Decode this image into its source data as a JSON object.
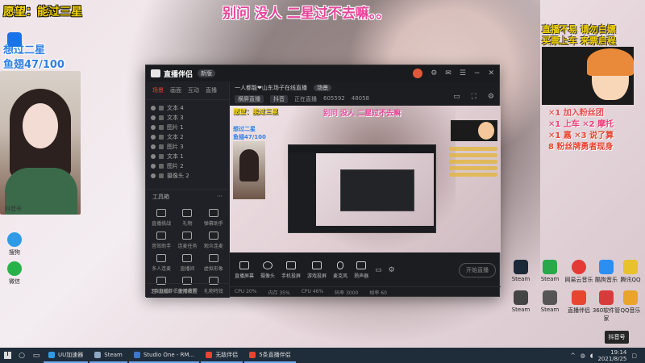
{
  "overlay": {
    "top_left": "愿望：能过三星",
    "top_center": "别问 没人 二星过不去嘛。。",
    "left_line1": "想过二星",
    "left_line2": "鱼翅47/100",
    "cam_label": "抖音号"
  },
  "desktop_left": [
    {
      "label": "抖音号",
      "color": "#1a73e8"
    },
    {
      "label": "搜狗",
      "color": "#2f9be6"
    },
    {
      "label": "微信",
      "color": "#27b34a"
    }
  ],
  "right_panel": {
    "title_line1": "直播不易 请勿白嫖",
    "title_line2": "买票上车 来票启程",
    "lines": [
      {
        "text": "✕1 加入粉丝团",
        "color": "#e84a4a"
      },
      {
        "text": "✕1 上车  ✕2 摩托",
        "color": "#ef3f7a"
      },
      {
        "text": "✕1 嘉  ✕3 说了算",
        "color": "#e8452f"
      },
      {
        "text": "8 粉丝牌勇者现身",
        "color": "#e8452f"
      }
    ]
  },
  "app": {
    "name": "直播伴侣",
    "badge": "新版",
    "tabs": [
      "场景",
      "画面",
      "互动",
      "直播"
    ],
    "active_tab": "场景",
    "layers": [
      "文本 4",
      "文本 3",
      "图片 1",
      "文本 2",
      "图片 3",
      "文本 1",
      "图片 2",
      "摄像头 2"
    ],
    "tools_title": "工具箱",
    "tools": [
      {
        "label": "直播挑战"
      },
      {
        "label": "礼物"
      },
      {
        "label": "弹幕助手"
      },
      {
        "label": "音效助手"
      },
      {
        "label": "连麦任务"
      },
      {
        "label": "观众连麦"
      },
      {
        "label": "多人连麦"
      },
      {
        "label": "直播间"
      },
      {
        "label": "虚拟形象"
      },
      {
        "label": "互动玩法"
      },
      {
        "label": "直播设置"
      },
      {
        "label": "礼物特效"
      }
    ],
    "left_footer": "3条直播伴侣使用教程",
    "scene_title": "一人都能❤山东场子在线直播",
    "scene_tag": "场景",
    "row2": [
      "横屏直播",
      "抖音",
      "正在直播",
      "605592",
      "48058"
    ],
    "preview_tl": "愿望：能过三星",
    "preview_tc": "别问 没人 二星过不去嘛",
    "preview_l2_1": "想过二星",
    "preview_l2_2": "鱼翅47/100",
    "controls": [
      {
        "label": "直播屏幕"
      },
      {
        "label": "摄像头"
      },
      {
        "label": "手机投屏"
      },
      {
        "label": "游戏投屏"
      },
      {
        "label": "麦克风"
      },
      {
        "label": "扬声器"
      }
    ],
    "start_label": "开始直播",
    "status": [
      "CPU 20%",
      "内存 35%",
      "CPU 46%",
      "码率 3000",
      "帧率 60"
    ]
  },
  "desktop_right": [
    {
      "label": "Steam"
    },
    {
      "label": "Steam"
    },
    {
      "label": "网易云音乐"
    },
    {
      "label": "酷狗音乐"
    },
    {
      "label": "腾讯QQ"
    },
    {
      "label": "Steam"
    },
    {
      "label": "Steam"
    },
    {
      "label": "直播伴侣"
    },
    {
      "label": "360软件管家"
    },
    {
      "label": "QQ音乐"
    }
  ],
  "taskbar": {
    "items": [
      {
        "label": "UU加速器",
        "color": "#2f9be6"
      },
      {
        "label": "Steam",
        "color": "#1b2838"
      },
      {
        "label": "Studio One - RM...",
        "color": "#3c78c8"
      },
      {
        "label": "无敌伴侣",
        "color": "#e8452f"
      },
      {
        "label": "5条直播伴侣",
        "color": "#e8452f"
      }
    ],
    "time": "19:14",
    "date": "2021/8/25"
  },
  "badge_br": "抖音号"
}
